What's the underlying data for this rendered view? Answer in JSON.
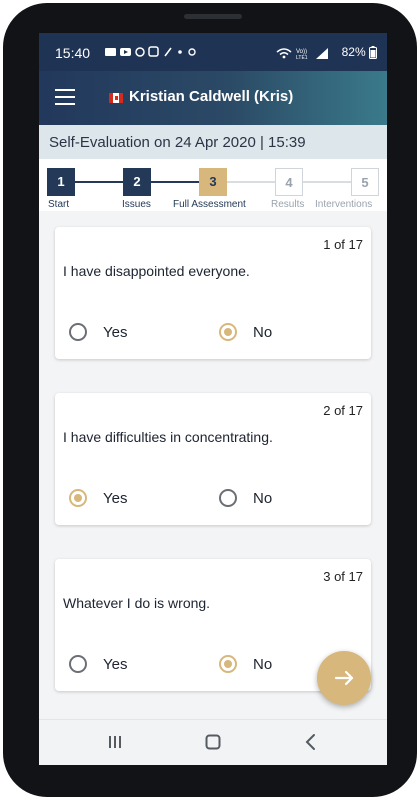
{
  "status_bar": {
    "time": "15:40",
    "signal_label": "Vo)) LTE1 ll",
    "battery": "82%"
  },
  "app_bar": {
    "title": "Kristian Caldwell (Kris)",
    "flag": "canada-flag"
  },
  "subheader": {
    "text": "Self-Evaluation on 24 Apr 2020 | 15:39"
  },
  "steps": [
    {
      "number": "1",
      "label": "Start",
      "state": "done"
    },
    {
      "number": "2",
      "label": "Issues",
      "state": "done"
    },
    {
      "number": "3",
      "label": "Full Assessment",
      "state": "active"
    },
    {
      "number": "4",
      "label": "Results",
      "state": "todo"
    },
    {
      "number": "5",
      "label": "Interventions",
      "state": "todo"
    }
  ],
  "questions": [
    {
      "count": "1 of 17",
      "text": "I have disappointed everyone.",
      "yes_label": "Yes",
      "no_label": "No",
      "selected": "No"
    },
    {
      "count": "2 of 17",
      "text": "I have difficulties in concentrating.",
      "yes_label": "Yes",
      "no_label": "No",
      "selected": "Yes"
    },
    {
      "count": "3 of 17",
      "text": "Whatever I do is wrong.",
      "yes_label": "Yes",
      "no_label": "No",
      "selected": "No"
    }
  ],
  "fab": {
    "icon": "arrow-right-icon"
  },
  "colors": {
    "navy": "#243957",
    "gold": "#d7b77c",
    "subheader_bg": "#dde6ea",
    "muted": "#9aa3ad"
  }
}
